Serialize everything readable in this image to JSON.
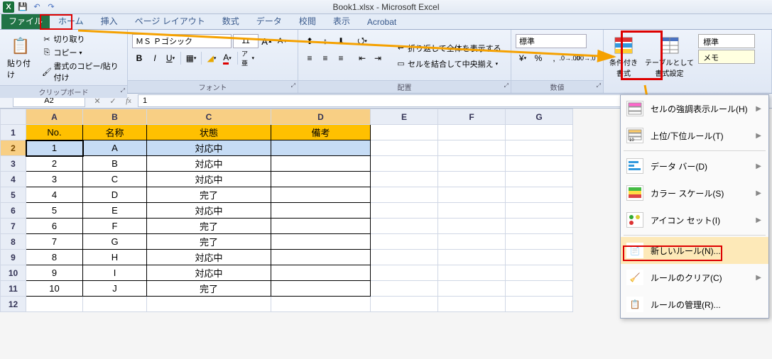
{
  "title": "Book1.xlsx - Microsoft Excel",
  "tabs": {
    "file": "ファイル",
    "home": "ホーム",
    "insert": "挿入",
    "page_layout": "ページ レイアウト",
    "formulas": "数式",
    "data": "データ",
    "review": "校閲",
    "view": "表示",
    "acrobat": "Acrobat"
  },
  "ribbon": {
    "clipboard": {
      "paste": "貼り付け",
      "cut": "切り取り",
      "copy": "コピー",
      "format_painter": "書式のコピー/貼り付け",
      "label": "クリップボード"
    },
    "font": {
      "name": "ＭＳ Ｐゴシック",
      "size": "11",
      "label": "フォント"
    },
    "alignment": {
      "wrap": "折り返して全体を表示する",
      "merge": "セルを結合して中央揃え",
      "label": "配置"
    },
    "number": {
      "format": "標準",
      "label": "数値"
    },
    "styles": {
      "cond_fmt": "条件付き\n書式",
      "table_fmt": "テーブルとして\n書式設定",
      "cell_styles_top": "標準",
      "cell_styles_bottom": "メモ"
    }
  },
  "namebox": "A2",
  "formula": "1",
  "columns": [
    "A",
    "B",
    "C",
    "D",
    "E",
    "F",
    "G"
  ],
  "table": {
    "headers": [
      "No.",
      "名称",
      "状態",
      "備考"
    ],
    "rows": [
      [
        "1",
        "A",
        "対応中",
        ""
      ],
      [
        "2",
        "B",
        "対応中",
        ""
      ],
      [
        "3",
        "C",
        "対応中",
        ""
      ],
      [
        "4",
        "D",
        "完了",
        ""
      ],
      [
        "5",
        "E",
        "対応中",
        ""
      ],
      [
        "6",
        "F",
        "完了",
        ""
      ],
      [
        "7",
        "G",
        "完了",
        ""
      ],
      [
        "8",
        "H",
        "対応中",
        ""
      ],
      [
        "9",
        "I",
        "対応中",
        ""
      ],
      [
        "10",
        "J",
        "完了",
        ""
      ]
    ]
  },
  "cf_menu": {
    "highlight_rules": "セルの強調表示ルール(H)",
    "top_bottom": "上位/下位ルール(T)",
    "data_bars": "データ バー(D)",
    "color_scales": "カラー スケール(S)",
    "icon_sets": "アイコン セット(I)",
    "new_rule": "新しいルール(N)...",
    "clear_rules": "ルールのクリア(C)",
    "manage_rules": "ルールの管理(R)..."
  }
}
